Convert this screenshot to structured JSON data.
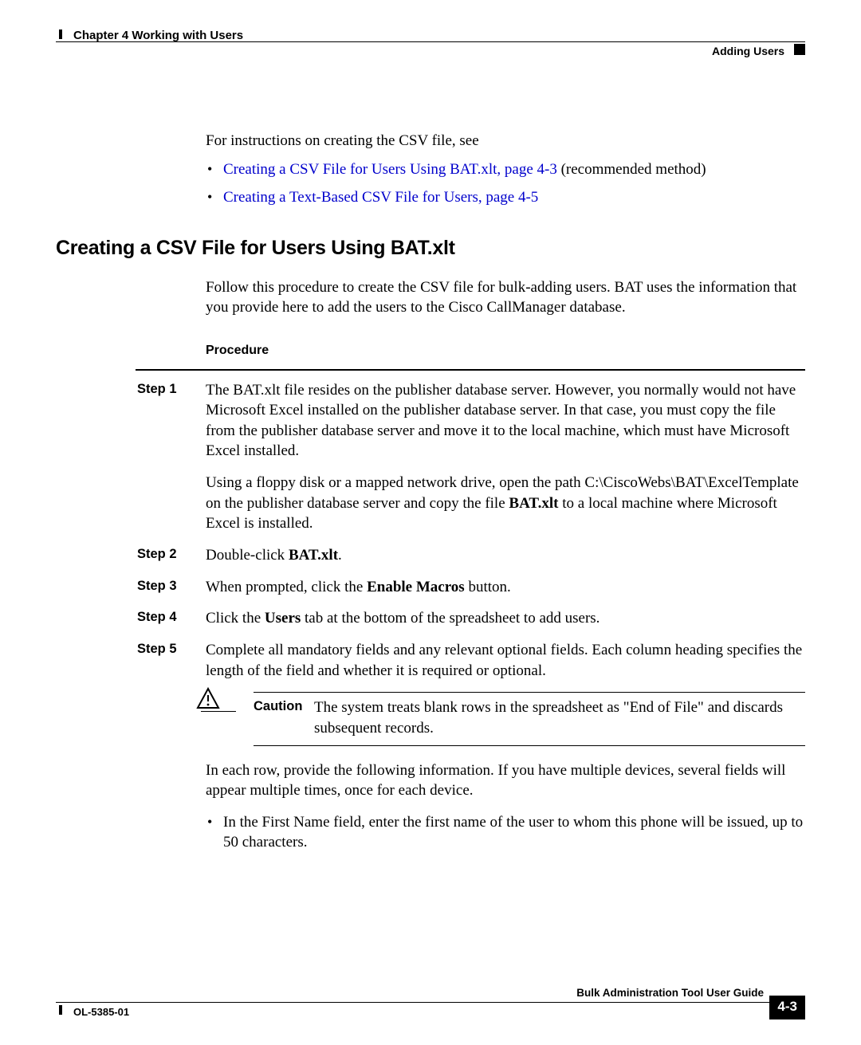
{
  "header": {
    "chapter": "Chapter 4      Working with Users",
    "section": "Adding Users"
  },
  "intro": "For instructions on creating the CSV file, see",
  "bullets": [
    {
      "link": "Creating a CSV File for Users Using BAT.xlt, page 4-3",
      "after": " (recommended method)"
    },
    {
      "link": "Creating a Text-Based CSV File for Users, page 4-5",
      "after": ""
    }
  ],
  "section_title": "Creating a CSV File for Users Using BAT.xlt",
  "section_intro": "Follow this procedure to create the CSV file for bulk-adding users. BAT uses the information that you provide here to add the users to the Cisco CallManager database.",
  "procedure_label": "Procedure",
  "steps": {
    "s1_label": "Step 1",
    "s1_p1": "The BAT.xlt file resides on the publisher database server. However, you normally would not have Microsoft Excel installed on the publisher database server. In that case, you must copy the file from the publisher database server and move it to the local machine, which must have Microsoft Excel installed.",
    "s1_p2a": "Using a floppy disk or a mapped network drive, open the path C:\\CiscoWebs\\BAT\\ExcelTemplate on the publisher database server and copy the file ",
    "s1_p2b": "BAT.xlt",
    "s1_p2c": " to a local machine where Microsoft Excel is installed.",
    "s2_label": "Step 2",
    "s2a": "Double-click ",
    "s2b": "BAT.xlt",
    "s2c": ".",
    "s3_label": "Step 3",
    "s3a": "When prompted, click the ",
    "s3b": "Enable Macros",
    "s3c": " button.",
    "s4_label": "Step 4",
    "s4a": "Click the ",
    "s4b": "Users",
    "s4c": " tab at the bottom of the spreadsheet to add users.",
    "s5_label": "Step 5",
    "s5": "Complete all mandatory fields and any relevant optional fields. Each column heading specifies the length of the field and whether it is required or optional."
  },
  "caution": {
    "label": "Caution",
    "text": "The system treats blank rows in the spreadsheet as \"End of File\" and discards subsequent records."
  },
  "after_caution": "In each row, provide the following information. If you have multiple devices, several fields will appear multiple times, once for each device.",
  "sub_bullet": "In the First Name field, enter the first name of the user to whom this phone will be issued, up to 50 characters.",
  "footer": {
    "guide": "Bulk Administration Tool User Guide",
    "doc": "OL-5385-01",
    "page": "4-3"
  }
}
